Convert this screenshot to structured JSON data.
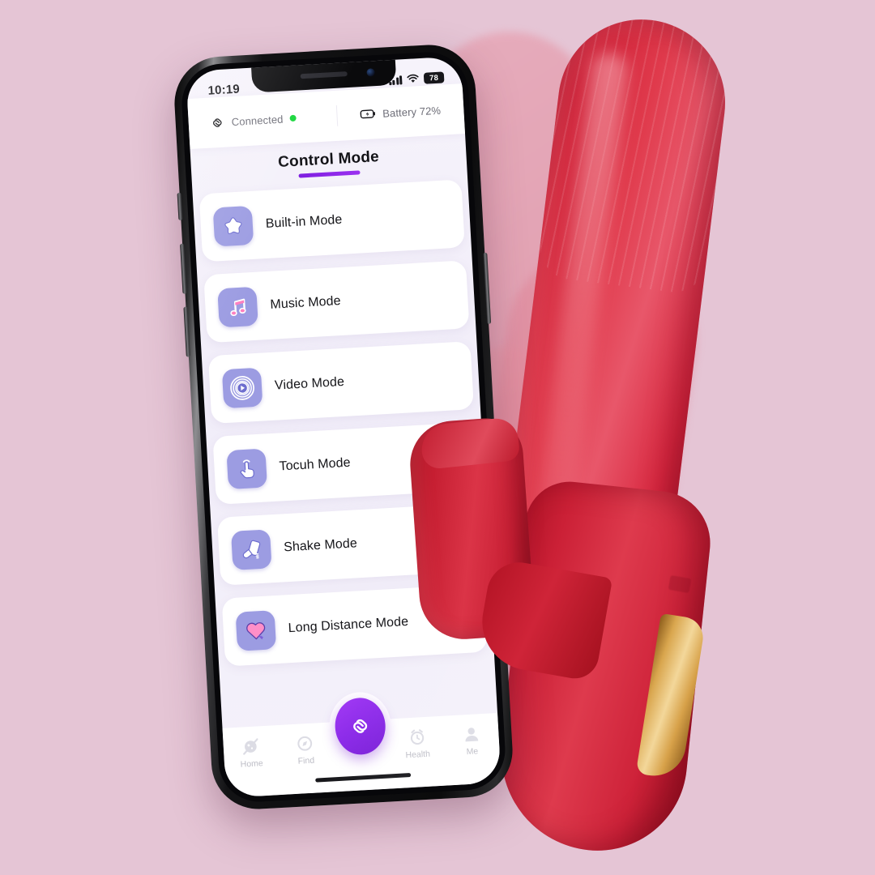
{
  "background_color": "#E5C5D5",
  "phone": {
    "status_bar": {
      "clock": "10:19",
      "signal_icon": "signal-bars-icon",
      "wifi_icon": "wifi-icon",
      "battery_level": "78"
    },
    "home_indicator": "home-indicator"
  },
  "app": {
    "connection": {
      "icon": "link-icon",
      "label": "Connected",
      "status_dot_color": "#17D63B"
    },
    "battery": {
      "icon": "battery-bolt-icon",
      "label": "Battery 72%"
    },
    "header": {
      "title": "Control Mode",
      "underline_color": "#8B2BE8"
    },
    "modes": [
      {
        "label": "Built-in Mode",
        "icon": "star-icon"
      },
      {
        "label": "Music Mode",
        "icon": "music-note-icon"
      },
      {
        "label": "Video Mode",
        "icon": "video-play-icon"
      },
      {
        "label": "Tocuh Mode",
        "icon": "touch-hand-icon"
      },
      {
        "label": "Shake Mode",
        "icon": "shake-phone-icon"
      },
      {
        "label": "Long Distance Mode",
        "icon": "heart-icon"
      }
    ],
    "tabbar": {
      "items": [
        {
          "label": "Home",
          "icon": "planet-icon"
        },
        {
          "label": "Find",
          "icon": "compass-icon"
        },
        {
          "label": "Health",
          "icon": "alarm-clock-icon"
        },
        {
          "label": "Me",
          "icon": "person-icon"
        }
      ],
      "fab": {
        "icon": "link-icon",
        "color": "#8B2BE8"
      }
    }
  },
  "product": {
    "name": "rabbit-vibrator",
    "body_color": "#D62B40",
    "accent_color": "#E0B15E",
    "motion_ghost": "motion-blur-afterimage"
  }
}
